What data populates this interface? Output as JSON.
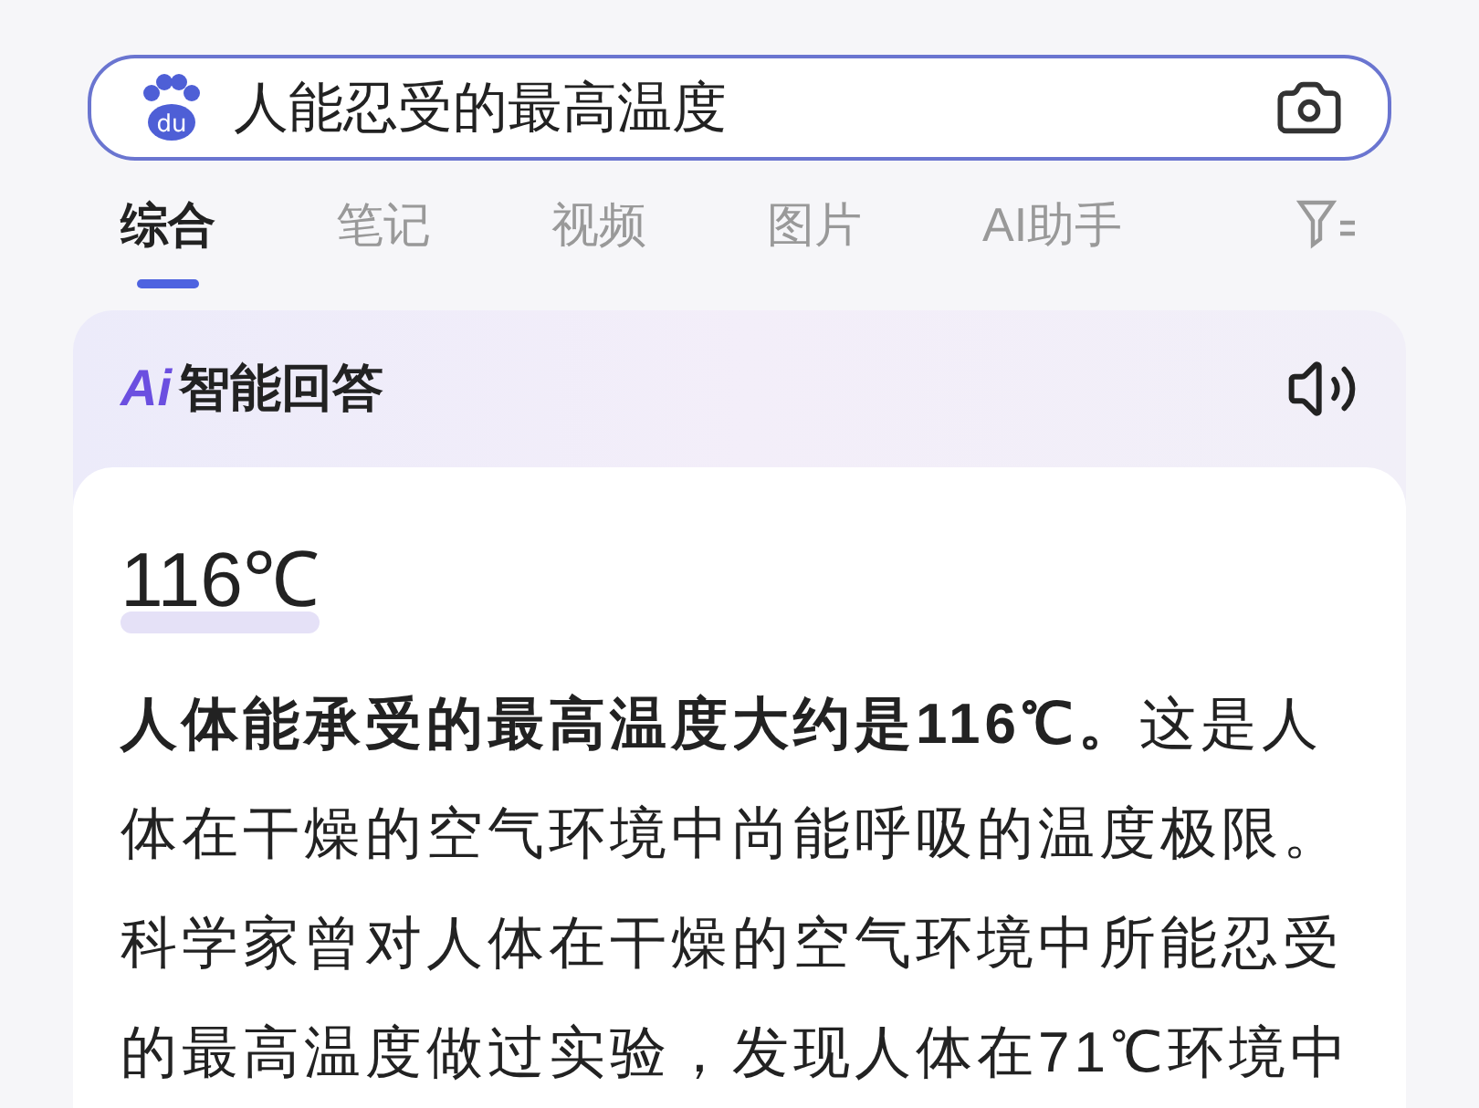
{
  "search": {
    "logo_text": "du",
    "value": "人能忍受的最高温度"
  },
  "tabs": [
    {
      "label": "综合",
      "selected": true
    },
    {
      "label": "笔记",
      "selected": false
    },
    {
      "label": "视频",
      "selected": false
    },
    {
      "label": "图片",
      "selected": false
    },
    {
      "label": "AI助手",
      "selected": false
    }
  ],
  "answer": {
    "badge": "Ai",
    "title": "智能回答",
    "headline": "116℃",
    "body": "**人体能承受的最高温度大约是116℃。**这是人体在干燥的空气环境中尚能呼吸的温度极限。科学家曾对人体在干燥的空气环境中所能忍受的最高温度做过实验，发现人体在71℃环境中"
  }
}
